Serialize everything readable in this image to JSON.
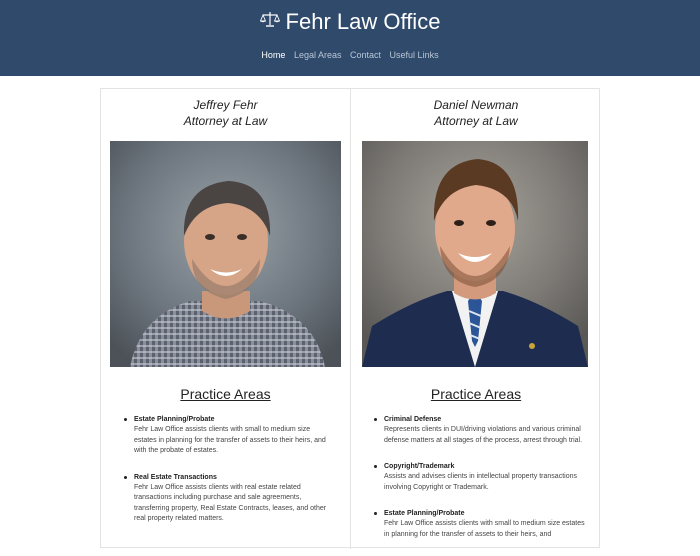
{
  "header": {
    "site_title": "Fehr Law Office",
    "logo_icon": "scale-icon",
    "nav": [
      {
        "label": "Home",
        "active": true
      },
      {
        "label": "Legal Areas",
        "active": false
      },
      {
        "label": "Contact",
        "active": false
      },
      {
        "label": "Useful Links",
        "active": false
      }
    ]
  },
  "attorneys": [
    {
      "name": "Jeffrey Fehr",
      "title": "Attorney at Law",
      "practice_heading": "Practice Areas",
      "areas": [
        {
          "title": "Estate Planning/Probate",
          "description": "Fehr Law Office assists clients with small to medium size estates in planning for the transfer of assets to their heirs, and with the probate of estates."
        },
        {
          "title": "Real Estate Transactions",
          "description": "Fehr Law Office assists clients with real estate related transactions including purchase and sale agreements, transferring property, Real Estate Contracts, leases, and other real property related matters."
        }
      ]
    },
    {
      "name": "Daniel Newman",
      "title": "Attorney at Law",
      "practice_heading": "Practice Areas",
      "areas": [
        {
          "title": "Criminal Defense",
          "description": "Represents clients in DUI/driving violations and various criminal defense matters at all stages of the process, arrest through trial."
        },
        {
          "title": "Copyright/Trademark",
          "description": "Assists and advises clients in intellectual property transactions involving Copyright or Trademark."
        },
        {
          "title": "Estate Planning/Probate",
          "description": "Fehr Law Office assists clients with small to medium size estates in planning for the transfer of assets to their heirs, and"
        }
      ]
    }
  ],
  "colors": {
    "header_bg": "#2f4a6b",
    "nav_inactive": "#b9c6d6",
    "nav_active": "#ffffff"
  }
}
